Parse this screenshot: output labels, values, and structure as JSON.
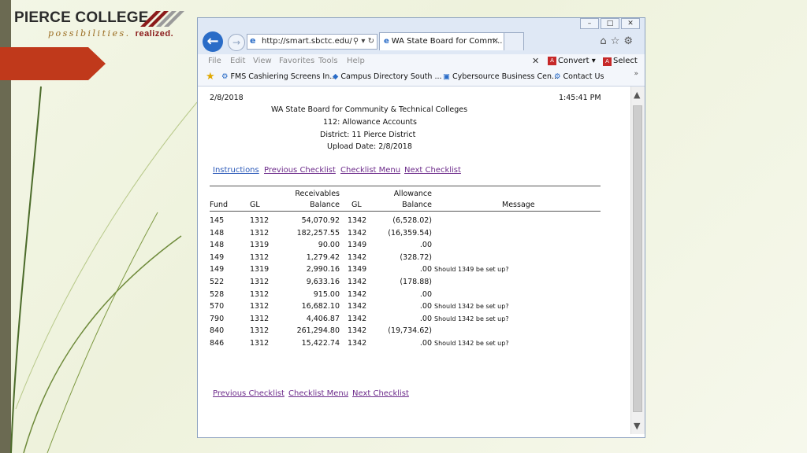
{
  "slide": {
    "logo_main": "PIERCE COLLEGE",
    "logo_sub_italic": "possibilities.",
    "logo_sub_bold": "realized."
  },
  "browser": {
    "address": "http://smart.sbctc.edu/",
    "tab_title": "WA State Board for Comm...",
    "menu": [
      "File",
      "Edit",
      "View",
      "Favorites",
      "Tools",
      "Help"
    ],
    "convert_label": "Convert",
    "select_label": "Select",
    "favorites": [
      "FMS Cashiering Screens In...",
      "Campus Directory  South ...",
      "Cybersource Business Cen...",
      "Contact Us"
    ]
  },
  "report": {
    "date": "2/8/2018",
    "time": "1:45:41 PM",
    "org": "WA State Board for Community & Technical Colleges",
    "title": "112: Allowance Accounts",
    "district": "District: 11  Pierce District",
    "upload": "Upload Date: 2/8/2018",
    "top_links": [
      "Instructions",
      "Previous Checklist",
      "Checklist Menu",
      "Next Checklist"
    ],
    "bottom_links": [
      "Previous Checklist",
      "Checklist Menu",
      "Next Checklist"
    ],
    "headers": {
      "fund": "Fund",
      "gl": "GL",
      "recv_1": "Receivables",
      "recv_2": "Balance",
      "gl2": "GL",
      "allow_1": "Allowance",
      "allow_2": "Balance",
      "message": "Message"
    },
    "rows": [
      {
        "fund": "145",
        "gl": "1312",
        "recv": "54,070.92",
        "gl2": "1342",
        "allow": "(6,528.02)",
        "msg": ""
      },
      {
        "fund": "148",
        "gl": "1312",
        "recv": "182,257.55",
        "gl2": "1342",
        "allow": "(16,359.54)",
        "msg": ""
      },
      {
        "fund": "148",
        "gl": "1319",
        "recv": "90.00",
        "gl2": "1349",
        "allow": ".00",
        "msg": ""
      },
      {
        "fund": "149",
        "gl": "1312",
        "recv": "1,279.42",
        "gl2": "1342",
        "allow": "(328.72)",
        "msg": ""
      },
      {
        "fund": "149",
        "gl": "1319",
        "recv": "2,990.16",
        "gl2": "1349",
        "allow": ".00",
        "msg": "Should 1349 be set up?"
      },
      {
        "fund": "522",
        "gl": "1312",
        "recv": "9,633.16",
        "gl2": "1342",
        "allow": "(178.88)",
        "msg": ""
      },
      {
        "fund": "528",
        "gl": "1312",
        "recv": "915.00",
        "gl2": "1342",
        "allow": ".00",
        "msg": ""
      },
      {
        "fund": "570",
        "gl": "1312",
        "recv": "16,682.10",
        "gl2": "1342",
        "allow": ".00",
        "msg": "Should 1342 be set up?"
      },
      {
        "fund": "790",
        "gl": "1312",
        "recv": "4,406.87",
        "gl2": "1342",
        "allow": ".00",
        "msg": "Should 1342 be set up?"
      },
      {
        "fund": "840",
        "gl": "1312",
        "recv": "261,294.80",
        "gl2": "1342",
        "allow": "(19,734.62)",
        "msg": ""
      },
      {
        "fund": "846",
        "gl": "1312",
        "recv": "15,422.74",
        "gl2": "1342",
        "allow": ".00",
        "msg": "Should 1342 be set up?"
      }
    ]
  }
}
